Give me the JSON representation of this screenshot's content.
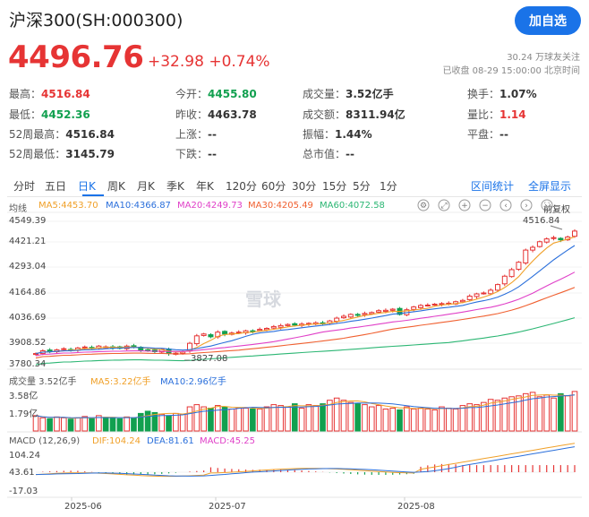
{
  "header": {
    "title": "沪深300(SH:000300)",
    "follow_button": "加自选",
    "price": "4496.76",
    "change": "+32.98",
    "change_pct": "+0.74%",
    "fans": "30.24 万球友关注",
    "status": "已收盘 08-29 15:00:00 北京时间"
  },
  "stats": [
    {
      "label": "最高：",
      "value": "4516.84",
      "color": "red"
    },
    {
      "label": "今开：",
      "value": "4455.80",
      "color": "green"
    },
    {
      "label": "成交量：",
      "value": "3.52亿手",
      "color": "normal"
    },
    {
      "label": "换手：",
      "value": "1.07%",
      "color": "normal"
    },
    {
      "label": "最低：",
      "value": "4452.36",
      "color": "green"
    },
    {
      "label": "昨收：",
      "value": "4463.78",
      "color": "normal"
    },
    {
      "label": "成交额：",
      "value": "8311.94亿",
      "color": "normal"
    },
    {
      "label": "量比：",
      "value": "1.14",
      "color": "red"
    },
    {
      "label": "52周最高：",
      "value": "4516.84",
      "color": "normal"
    },
    {
      "label": "上涨：",
      "value": "--",
      "color": "normal"
    },
    {
      "label": "振幅：",
      "value": "1.44%",
      "color": "normal"
    },
    {
      "label": "平盘：",
      "value": "--",
      "color": "normal"
    },
    {
      "label": "52周最低：",
      "value": "3145.79",
      "color": "normal"
    },
    {
      "label": "下跌：",
      "value": "--",
      "color": "normal"
    },
    {
      "label": "总市值：",
      "value": "--",
      "color": "normal"
    }
  ],
  "tabs": [
    "分时",
    "五日",
    "日K",
    "周K",
    "月K",
    "季K",
    "年K",
    "120分",
    "60分",
    "30分",
    "15分",
    "5分",
    "1分"
  ],
  "active_tab": "日K",
  "tools": {
    "interval_stats": "区间统计",
    "fullscreen": "全屏显示"
  },
  "chart_icons": [
    "settings-icon",
    "expand-icon",
    "add-icon",
    "minus-icon",
    "prev-icon",
    "next-icon",
    "fullscreen-icon"
  ],
  "kline": {
    "legend": {
      "label": "均线",
      "ma5": "MA5:4453.70",
      "ma10": "MA10:4366.87",
      "ma20": "MA20:4249.73",
      "ma30": "MA30:4205.49",
      "ma60": "MA60:4072.58"
    },
    "y_ticks": [
      "4549.39",
      "4421.21",
      "4293.04",
      "4164.86",
      "4036.69",
      "3908.52",
      "3780.34"
    ],
    "high_label": "4516.84",
    "low_label": "3827.08",
    "adjust_label": "前复权"
  },
  "volume": {
    "legend": {
      "label": "成交量 3.52亿手",
      "ma5": "MA5:3.22亿手",
      "ma10": "MA10:2.96亿手"
    },
    "y_ticks": [
      "3.58亿",
      "1.79亿"
    ]
  },
  "macd": {
    "legend": {
      "label": "MACD (12,26,9)",
      "dif": "DIF:104.24",
      "dea": "DEA:81.61",
      "macd": "MACD:45.25"
    },
    "y_ticks": [
      "104.24",
      "43.61",
      "-17.03"
    ]
  },
  "x_labels": [
    "2025-06",
    "2025-07",
    "2025-08"
  ],
  "watermark": "雪球",
  "colors": {
    "up": "#e63434",
    "down": "#11a04f",
    "ma5": "#f0a028",
    "ma10": "#2a6fdb",
    "ma20": "#e040c8",
    "ma30": "#f06030",
    "ma60": "#2bb673",
    "accent": "#1a73e8"
  },
  "chart_data": {
    "type": "candlestick",
    "series_name": "沪深300 日K",
    "ylim": [
      3780.34,
      4549.39
    ],
    "closes": [
      3840,
      3855,
      3852,
      3860,
      3866,
      3858,
      3870,
      3875,
      3868,
      3880,
      3876,
      3872,
      3868,
      3880,
      3878,
      3860,
      3855,
      3850,
      3862,
      3840,
      3842,
      3850,
      3895,
      3935,
      3945,
      3930,
      3955,
      3945,
      3950,
      3955,
      3962,
      3960,
      3970,
      3975,
      3985,
      3990,
      3996,
      3993,
      3998,
      4002,
      4005,
      4000,
      4015,
      4030,
      4040,
      4050,
      4045,
      4055,
      4060,
      4070,
      4072,
      4078,
      4050,
      4075,
      4090,
      4098,
      4100,
      4105,
      4108,
      4110,
      4118,
      4125,
      4148,
      4160,
      4165,
      4180,
      4210,
      4255,
      4290,
      4330,
      4395,
      4410,
      4440,
      4455,
      4462,
      4450,
      4465,
      4497
    ],
    "vol_heights": [
      0.35,
      0.3,
      0.28,
      0.32,
      0.3,
      0.27,
      0.3,
      0.33,
      0.28,
      0.35,
      0.31,
      0.3,
      0.28,
      0.32,
      0.3,
      0.4,
      0.45,
      0.42,
      0.38,
      0.35,
      0.4,
      0.38,
      0.55,
      0.6,
      0.55,
      0.52,
      0.58,
      0.55,
      0.5,
      0.53,
      0.52,
      0.5,
      0.5,
      0.55,
      0.6,
      0.58,
      0.55,
      0.62,
      0.52,
      0.6,
      0.58,
      0.62,
      0.7,
      0.75,
      0.7,
      0.65,
      0.62,
      0.6,
      0.55,
      0.58,
      0.5,
      0.52,
      0.48,
      0.55,
      0.5,
      0.52,
      0.5,
      0.48,
      0.55,
      0.52,
      0.5,
      0.58,
      0.62,
      0.6,
      0.65,
      0.72,
      0.7,
      0.75,
      0.78,
      0.8,
      0.85,
      0.88,
      0.78,
      0.82,
      0.75,
      0.85,
      0.8,
      0.9
    ],
    "x_ticks": [
      "2025-06",
      "2025-07",
      "2025-08"
    ]
  }
}
